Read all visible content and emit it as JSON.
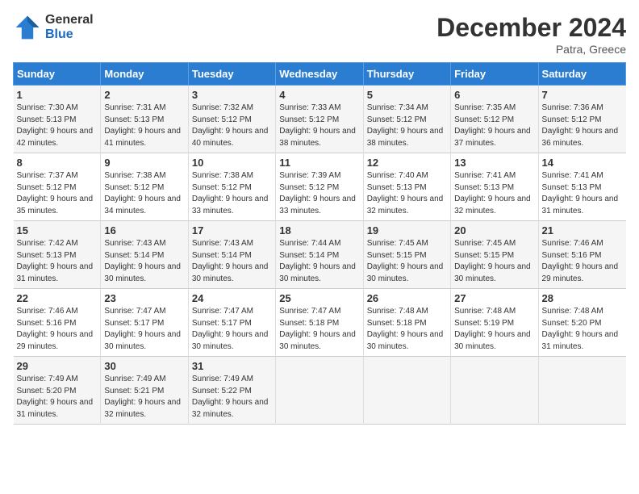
{
  "logo": {
    "general": "General",
    "blue": "Blue"
  },
  "title": "December 2024",
  "location": "Patra, Greece",
  "days_of_week": [
    "Sunday",
    "Monday",
    "Tuesday",
    "Wednesday",
    "Thursday",
    "Friday",
    "Saturday"
  ],
  "weeks": [
    [
      {
        "day": "1",
        "sunrise": "7:30 AM",
        "sunset": "5:13 PM",
        "daylight": "9 hours and 42 minutes."
      },
      {
        "day": "2",
        "sunrise": "7:31 AM",
        "sunset": "5:13 PM",
        "daylight": "9 hours and 41 minutes."
      },
      {
        "day": "3",
        "sunrise": "7:32 AM",
        "sunset": "5:12 PM",
        "daylight": "9 hours and 40 minutes."
      },
      {
        "day": "4",
        "sunrise": "7:33 AM",
        "sunset": "5:12 PM",
        "daylight": "9 hours and 38 minutes."
      },
      {
        "day": "5",
        "sunrise": "7:34 AM",
        "sunset": "5:12 PM",
        "daylight": "9 hours and 38 minutes."
      },
      {
        "day": "6",
        "sunrise": "7:35 AM",
        "sunset": "5:12 PM",
        "daylight": "9 hours and 37 minutes."
      },
      {
        "day": "7",
        "sunrise": "7:36 AM",
        "sunset": "5:12 PM",
        "daylight": "9 hours and 36 minutes."
      }
    ],
    [
      {
        "day": "8",
        "sunrise": "7:37 AM",
        "sunset": "5:12 PM",
        "daylight": "9 hours and 35 minutes."
      },
      {
        "day": "9",
        "sunrise": "7:38 AM",
        "sunset": "5:12 PM",
        "daylight": "9 hours and 34 minutes."
      },
      {
        "day": "10",
        "sunrise": "7:38 AM",
        "sunset": "5:12 PM",
        "daylight": "9 hours and 33 minutes."
      },
      {
        "day": "11",
        "sunrise": "7:39 AM",
        "sunset": "5:12 PM",
        "daylight": "9 hours and 33 minutes."
      },
      {
        "day": "12",
        "sunrise": "7:40 AM",
        "sunset": "5:13 PM",
        "daylight": "9 hours and 32 minutes."
      },
      {
        "day": "13",
        "sunrise": "7:41 AM",
        "sunset": "5:13 PM",
        "daylight": "9 hours and 32 minutes."
      },
      {
        "day": "14",
        "sunrise": "7:41 AM",
        "sunset": "5:13 PM",
        "daylight": "9 hours and 31 minutes."
      }
    ],
    [
      {
        "day": "15",
        "sunrise": "7:42 AM",
        "sunset": "5:13 PM",
        "daylight": "9 hours and 31 minutes."
      },
      {
        "day": "16",
        "sunrise": "7:43 AM",
        "sunset": "5:14 PM",
        "daylight": "9 hours and 30 minutes."
      },
      {
        "day": "17",
        "sunrise": "7:43 AM",
        "sunset": "5:14 PM",
        "daylight": "9 hours and 30 minutes."
      },
      {
        "day": "18",
        "sunrise": "7:44 AM",
        "sunset": "5:14 PM",
        "daylight": "9 hours and 30 minutes."
      },
      {
        "day": "19",
        "sunrise": "7:45 AM",
        "sunset": "5:15 PM",
        "daylight": "9 hours and 30 minutes."
      },
      {
        "day": "20",
        "sunrise": "7:45 AM",
        "sunset": "5:15 PM",
        "daylight": "9 hours and 30 minutes."
      },
      {
        "day": "21",
        "sunrise": "7:46 AM",
        "sunset": "5:16 PM",
        "daylight": "9 hours and 29 minutes."
      }
    ],
    [
      {
        "day": "22",
        "sunrise": "7:46 AM",
        "sunset": "5:16 PM",
        "daylight": "9 hours and 29 minutes."
      },
      {
        "day": "23",
        "sunrise": "7:47 AM",
        "sunset": "5:17 PM",
        "daylight": "9 hours and 30 minutes."
      },
      {
        "day": "24",
        "sunrise": "7:47 AM",
        "sunset": "5:17 PM",
        "daylight": "9 hours and 30 minutes."
      },
      {
        "day": "25",
        "sunrise": "7:47 AM",
        "sunset": "5:18 PM",
        "daylight": "9 hours and 30 minutes."
      },
      {
        "day": "26",
        "sunrise": "7:48 AM",
        "sunset": "5:18 PM",
        "daylight": "9 hours and 30 minutes."
      },
      {
        "day": "27",
        "sunrise": "7:48 AM",
        "sunset": "5:19 PM",
        "daylight": "9 hours and 30 minutes."
      },
      {
        "day": "28",
        "sunrise": "7:48 AM",
        "sunset": "5:20 PM",
        "daylight": "9 hours and 31 minutes."
      }
    ],
    [
      {
        "day": "29",
        "sunrise": "7:49 AM",
        "sunset": "5:20 PM",
        "daylight": "9 hours and 31 minutes."
      },
      {
        "day": "30",
        "sunrise": "7:49 AM",
        "sunset": "5:21 PM",
        "daylight": "9 hours and 32 minutes."
      },
      {
        "day": "31",
        "sunrise": "7:49 AM",
        "sunset": "5:22 PM",
        "daylight": "9 hours and 32 minutes."
      },
      null,
      null,
      null,
      null
    ]
  ]
}
